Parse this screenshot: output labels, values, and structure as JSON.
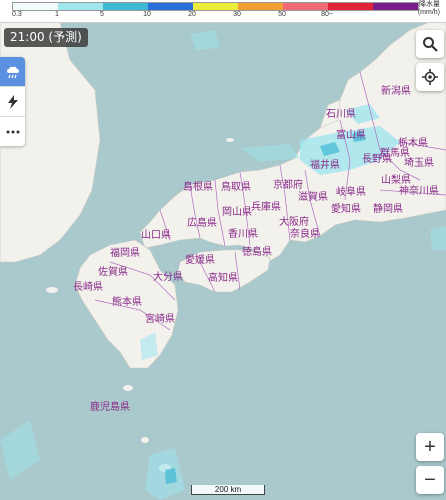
{
  "legend": {
    "ticks": [
      "0.3",
      "1",
      "5",
      "10",
      "20",
      "30",
      "50",
      "80~"
    ],
    "unit_line1": "降水量",
    "unit_line2": "(mm/h)",
    "colors": [
      "#f2fbfb",
      "#a0e6ef",
      "#3fb8d3",
      "#2b6fd8",
      "#ecec3a",
      "#f0a030",
      "#f06a75",
      "#e0233a",
      "#7a1e8a"
    ]
  },
  "time_label": "21:00 (予測)",
  "controls": {
    "rain_layer": "rain-icon",
    "lightning_layer": "lightning-icon",
    "more": "more-icon",
    "search": "search-icon",
    "locate": "locate-icon",
    "zoom_in": "+",
    "zoom_out": "−"
  },
  "scale_label": "200 km",
  "prefectures": {
    "niigata": "新潟県",
    "ishikawa": "石川県",
    "toyama": "富山県",
    "nagano": "長野県",
    "tochigi": "栃木県",
    "gunma": "群馬県",
    "saitama": "埼玉県",
    "yamanashi": "山梨県",
    "kanagawa": "神奈川県",
    "fukui": "福井県",
    "shimane": "島根県",
    "tottori": "鳥取県",
    "kyoto": "京都府",
    "shiga": "滋賀県",
    "gifu": "岐阜県",
    "aichi": "愛知県",
    "shizuoka": "静岡県",
    "hiroshima": "広島県",
    "okayama": "岡山県",
    "hyogo": "兵庫県",
    "osaka": "大阪府",
    "nara": "奈良県",
    "yamaguchi": "山口県",
    "kagawa": "香川県",
    "tokushima": "徳島県",
    "ehime": "愛媛県",
    "kochi": "高知県",
    "fukuoka": "福岡県",
    "saga": "佐賀県",
    "oita": "大分県",
    "nagasaki": "長崎県",
    "kumamoto": "熊本県",
    "miyazaki": "宮崎県",
    "kagoshima": "鹿児島県",
    "mie": "三重県",
    "wakayama": "和歌山県"
  }
}
